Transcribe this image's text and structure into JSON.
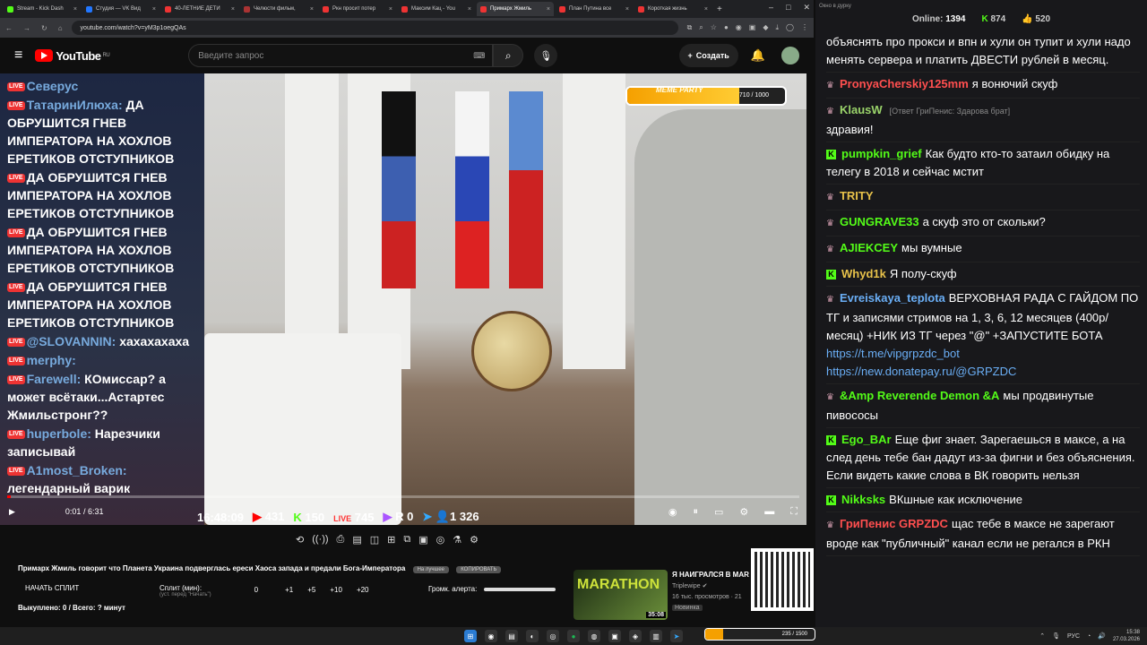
{
  "browser": {
    "tabs": [
      {
        "label": "Stream - Kick Dash"
      },
      {
        "label": "Студия — VK Вид"
      },
      {
        "label": "40-ЛЕТНИЕ ДЕТИ"
      },
      {
        "label": "Челюсти фильм,"
      },
      {
        "label": "Ркн просит потер"
      },
      {
        "label": "Максим Кац - You"
      },
      {
        "label": "Примарх Жмиль"
      },
      {
        "label": "План Путина все"
      },
      {
        "label": "Короткая жизнь"
      }
    ],
    "url": "youtube.com/watch?v=yM3p1oegQAs"
  },
  "youtube": {
    "logo": "YouTube",
    "region": "RU",
    "search_placeholder": "Введите запрос",
    "create_label": "Создать"
  },
  "stream_chat": [
    {
      "user": "Северус",
      "text": ""
    },
    {
      "user": "ТатаринИлюха:",
      "text": "ДА ОБРУШИТСЯ ГНЕВ ИМПЕРАТОРА НА ХОХЛОВ ЕРЕТИКОВ ОТСТУПНИКОВ"
    },
    {
      "user": "",
      "text": "ДА ОБРУШИТСЯ ГНЕВ ИМПЕРАТОРА НА ХОХЛОВ ЕРЕТИКОВ ОТСТУПНИКОВ"
    },
    {
      "user": "",
      "text": "ДА ОБРУШИТСЯ ГНЕВ ИМПЕРАТОРА НА ХОХЛОВ ЕРЕТИКОВ ОТСТУПНИКОВ"
    },
    {
      "user": "",
      "text": "ДА ОБРУШИТСЯ ГНЕВ ИМПЕРАТОРА НА ХОХЛОВ ЕРЕТИКОВ ОТСТУПНИКОВ"
    },
    {
      "user": "@SLOVANNIN:",
      "text": "хахахахаха"
    },
    {
      "user": "merphy:",
      "text": ""
    },
    {
      "user": "Farewell:",
      "text": "КОмиссар? а может всётаки...Астартес Жмильстронг??"
    },
    {
      "user": "huperbole:",
      "text": "Нарезчики записывай"
    },
    {
      "user": "A1most_Broken:",
      "text": "легендарный варик"
    }
  ],
  "overlay": {
    "stream_time": "16:48:09",
    "youtube_count": "431",
    "kick_count": "150",
    "vk_count": "745",
    "rutube_count": "0",
    "viewers": "1 326",
    "meme_label": "MEME PARTY",
    "meme_count": "710 / 1000",
    "meme_progress": 0.71
  },
  "player": {
    "time": "0:01 / 6:31",
    "progress": 0.003
  },
  "below": {
    "title": "Примарх Жмиль говорит что Планета Украина подверглась ереси Хаоса запада и предали Бога-Императора",
    "pill1": "На лучшее",
    "pill2": "КОПИРОВАТЬ",
    "split_label": "НАЧАТЬ СПЛИТ",
    "split_min_label": "Сплит (мин):",
    "split_sub": "(уст. перед \"Начать\")",
    "split_values": [
      "0",
      "+1",
      "+5",
      "+10",
      "+20"
    ],
    "alert_label": "Громк. алерта:",
    "bought": "Выкуплено: 0 / Всего: ? минут"
  },
  "card": {
    "thumb_text": "MARATHON",
    "duration": "35:08",
    "title": "Я НАИГРАЛСЯ В MAR",
    "channel": "Triplewipe",
    "views": "16 тыс. просмотров · 21",
    "badge": "Новинка"
  },
  "chat_window": {
    "title": "Окно в дурку",
    "online_label": "Online:",
    "online": "1394",
    "stat1": "874",
    "stat2": "520",
    "messages": [
      {
        "user": "",
        "color": "#ffffff",
        "text": "объяснять про прокси и впн и хули он тупит и хули надо менять сервера и платить ДВЕСТИ рублей в месяц.",
        "kind": "none"
      },
      {
        "user": "PronyaCherskiy125mm",
        "color": "#ff4f4f",
        "text": "я вонючий скуф",
        "kind": "crown"
      },
      {
        "user": "KlausW",
        "color": "#9ad36a",
        "text": "здравия!",
        "kind": "crown",
        "reply": "[Ответ ГриПенис: Здарова брат]"
      },
      {
        "user": "pumpkin_grief",
        "color": "#53fc18",
        "text": "Как будто кто-то затаил обидку на телегу в 2018 и сейчас мстит",
        "kind": "kick"
      },
      {
        "user": "TRITY",
        "color": "#e8c24a",
        "text": "",
        "kind": "crown"
      },
      {
        "user": "GUNGRAVE33",
        "color": "#53fc18",
        "text": "а скуф это от скольки?",
        "kind": "crown"
      },
      {
        "user": "AJIEKCEY",
        "color": "#53fc18",
        "text": "мы вумные",
        "kind": "crown"
      },
      {
        "user": "Whyd1k",
        "color": "#e8c24a",
        "text": "Я полу-скуф",
        "kind": "kick"
      },
      {
        "user": "Evreiskaya_teplota",
        "color": "#6aaef5",
        "text": "ВЕРХОВНАЯ РАДА С ГАЙДОМ ПО ТГ и записями стримов на 1, 3, 6, 12 месяцев (400р/месяц) +НИК ИЗ ТГ через \"@\" +ЗАПУСТИТЕ БОТА",
        "kind": "crown",
        "link1": "https://t.me/vipgrpzdc_bot",
        "link2": "https://new.donatepay.ru/@GRPZDC"
      },
      {
        "user": "&Amp Reverende Demon &A",
        "color": "#53fc18",
        "text": "мы продвинутые пивососы",
        "kind": "crown"
      },
      {
        "user": "Ego_BAr",
        "color": "#53fc18",
        "text": "Еще фиг знает. Зарегаешься в максе, а на след день тебе бан дадут из-за фигни и без объяснения. Если видеть какие слова в ВК говорить нельзя",
        "kind": "kick"
      },
      {
        "user": "Nikksks",
        "color": "#53fc18",
        "text": "ВКшные как исключение",
        "kind": "kick"
      },
      {
        "user": "ГриПенис GRPZDC",
        "color": "#ff4f4f",
        "text": "щас тебе в максе не зарегают вроде как \"публичный\" канал если не регался в РКН",
        "kind": "crown"
      }
    ]
  },
  "taskbar": {
    "lang": "РУС",
    "time": "15:38",
    "date": "27.03.2026",
    "meme_count": "235 / 1500"
  },
  "colors": {
    "accent": "#ff0000",
    "kick": "#53fc18",
    "meme": "#f5a000"
  }
}
